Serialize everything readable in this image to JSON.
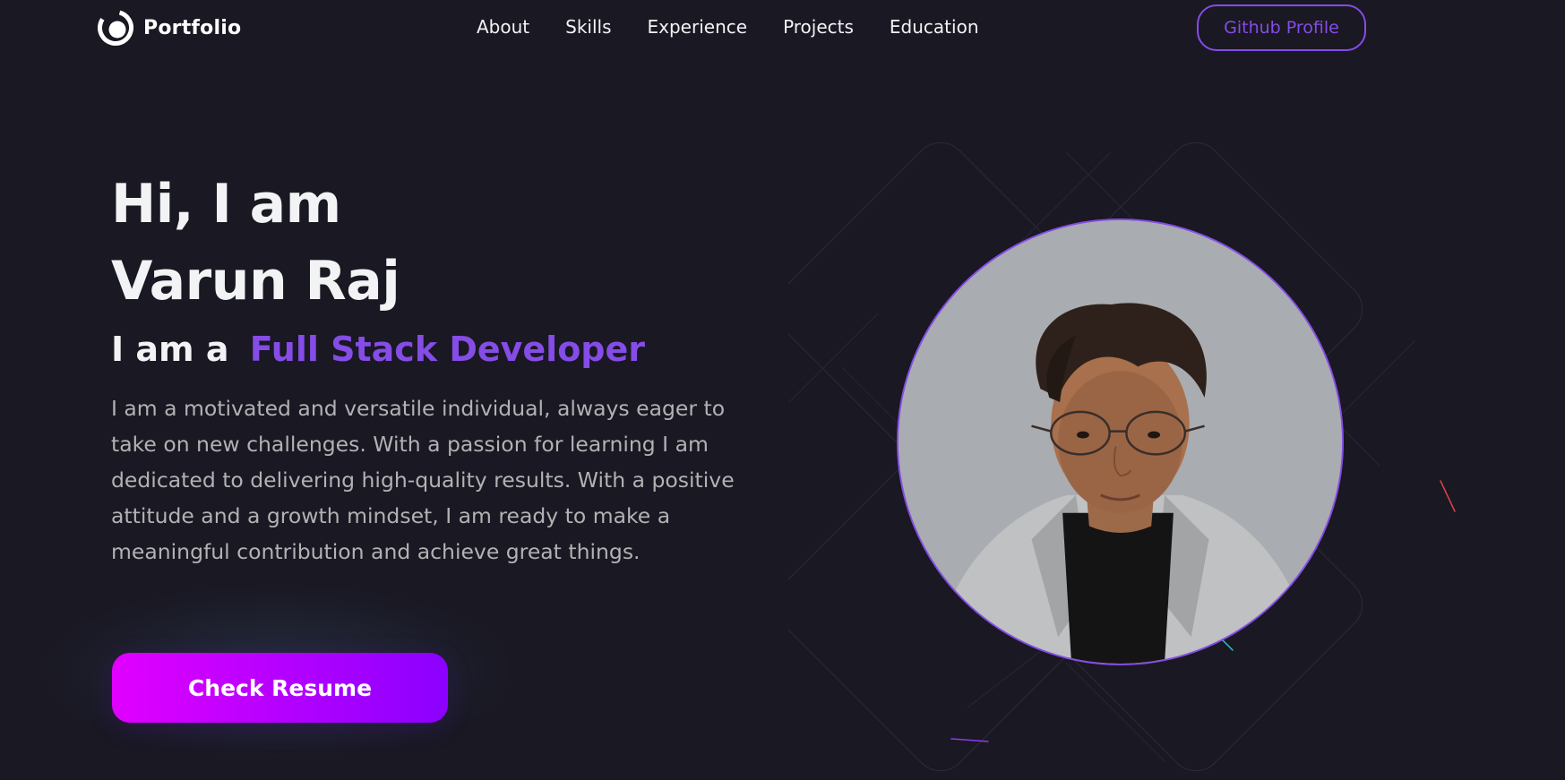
{
  "nav": {
    "logo_text": "Portfolio",
    "logo_icon": "portfolio-logo-icon",
    "links": [
      "About",
      "Skills",
      "Experience",
      "Projects",
      "Education"
    ],
    "github_label": "Github Profile"
  },
  "hero": {
    "greeting": "Hi, I am",
    "name": "Varun Raj",
    "role_prefix": "I am a",
    "role_title": "Full Stack Developer",
    "bio": "I am a motivated and versatile individual, always eager to take on new challenges. With a passion for learning I am dedicated to delivering high-quality results. With a positive attitude and a growth mindset, I am ready to make a meaningful contribution and achieve great things.",
    "resume_label": "Check Resume"
  },
  "colors": {
    "background": "#191823",
    "accent": "#854ce6",
    "text_primary": "#f2f3f4",
    "text_secondary": "#b1b2b3",
    "button_gradient_start": "#e100ff",
    "button_gradient_end": "#8b00ff"
  }
}
